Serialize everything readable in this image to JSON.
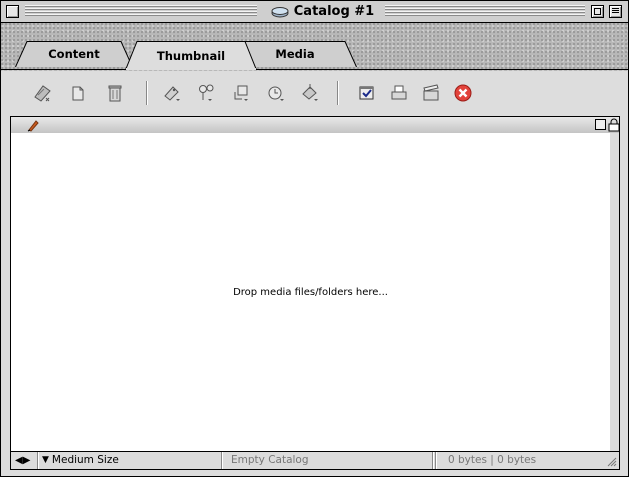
{
  "window": {
    "title": "Catalog #1"
  },
  "tabs": [
    {
      "label": "Content",
      "active": false
    },
    {
      "label": "Thumbnail",
      "active": true
    },
    {
      "label": "Media",
      "active": false
    }
  ],
  "toolbar": {
    "icons": [
      "new-annotation-icon",
      "copy-icon",
      "trash-icon",
      "label-icon",
      "keyword-icon",
      "crop-icon",
      "clock-icon",
      "fill-icon",
      "checklist-icon",
      "print-icon",
      "slideshow-icon",
      "stop-icon"
    ]
  },
  "content": {
    "drop_hint": "Drop media files/folders here..."
  },
  "status": {
    "view_size": "Medium Size",
    "catalog_state": "Empty Catalog",
    "size_info": "0 bytes | 0 bytes"
  },
  "colors": {
    "stop_red": "#e2433b",
    "content_bg": "#ffffff",
    "chrome_bg": "#dddddd"
  }
}
